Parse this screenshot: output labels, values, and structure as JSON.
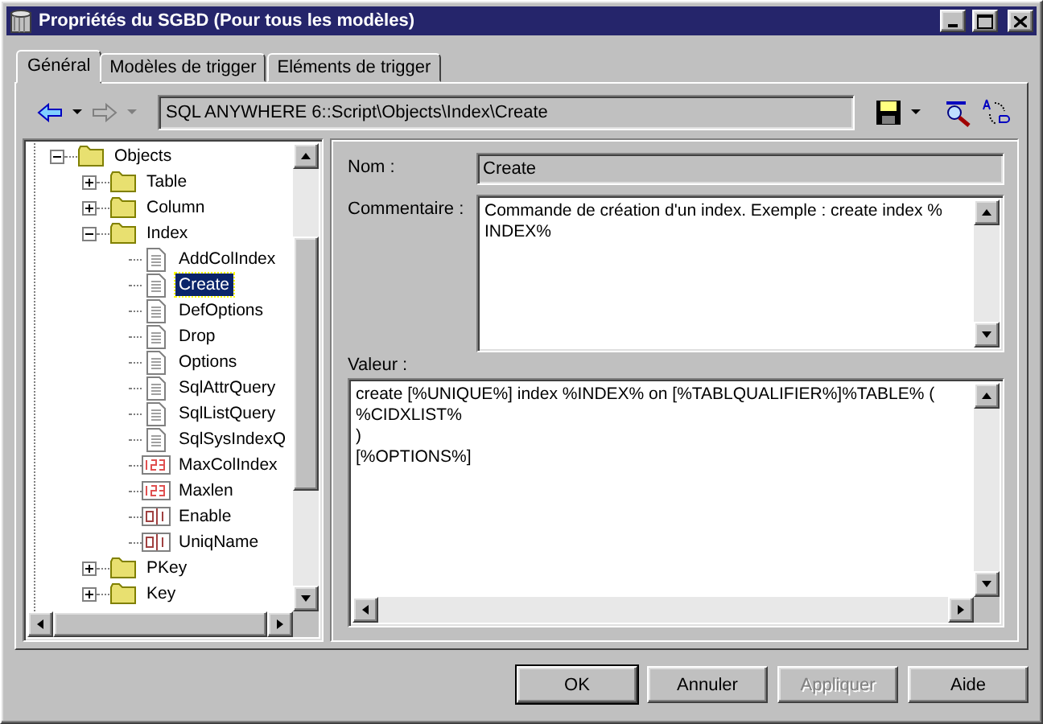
{
  "window": {
    "title": "Propriétés du SGBD (Pour tous les modèles)"
  },
  "tabs": [
    {
      "label": "Général",
      "selected": true
    },
    {
      "label": "Modèles de trigger",
      "selected": false
    },
    {
      "label": "Eléments de trigger",
      "selected": false
    }
  ],
  "toolbar": {
    "back_disabled": false,
    "forward_disabled": true,
    "path": "SQL ANYWHERE 6::Script\\Objects\\Index\\Create"
  },
  "tree": [
    {
      "label": "Objects",
      "kind": "folder",
      "expanded": true,
      "selected": false,
      "children": [
        {
          "label": "Table",
          "kind": "folder",
          "expanded": false,
          "selected": false
        },
        {
          "label": "Column",
          "kind": "folder",
          "expanded": false,
          "selected": false
        },
        {
          "label": "Index",
          "kind": "folder",
          "expanded": true,
          "selected": false,
          "children": [
            {
              "label": "AddColIndex",
              "kind": "script",
              "selected": false
            },
            {
              "label": "Create",
              "kind": "script",
              "selected": true
            },
            {
              "label": "DefOptions",
              "kind": "script",
              "selected": false
            },
            {
              "label": "Drop",
              "kind": "script",
              "selected": false
            },
            {
              "label": "Options",
              "kind": "script",
              "selected": false
            },
            {
              "label": "SqlAttrQuery",
              "kind": "script",
              "selected": false
            },
            {
              "label": "SqlListQuery",
              "kind": "script",
              "selected": false
            },
            {
              "label": "SqlSysIndexQ",
              "kind": "script",
              "selected": false
            },
            {
              "label": "MaxColIndex",
              "kind": "number",
              "selected": false
            },
            {
              "label": "Maxlen",
              "kind": "number",
              "selected": false
            },
            {
              "label": "Enable",
              "kind": "boolean",
              "selected": false
            },
            {
              "label": "UniqName",
              "kind": "boolean",
              "selected": false
            }
          ]
        },
        {
          "label": "PKey",
          "kind": "folder",
          "expanded": false,
          "selected": false
        },
        {
          "label": "Key",
          "kind": "folder",
          "expanded": false,
          "selected": false
        }
      ]
    }
  ],
  "form": {
    "name_label": "Nom :",
    "name_value": "Create",
    "comment_label": "Commentaire :",
    "comment_value": "Commande de création d'un index. Exemple : create index %\nINDEX%",
    "value_label": "Valeur :",
    "value_value": "create [%UNIQUE%] index %INDEX% on [%TABLQUALIFIER%]%TABLE% (\n%CIDXLIST%\n)\n[%OPTIONS%]"
  },
  "buttons": [
    {
      "label": "OK",
      "disabled": false,
      "default": true
    },
    {
      "label": "Annuler",
      "disabled": false,
      "default": false
    },
    {
      "label": "Appliquer",
      "disabled": true,
      "default": false
    },
    {
      "label": "Aide",
      "disabled": false,
      "default": false
    }
  ]
}
